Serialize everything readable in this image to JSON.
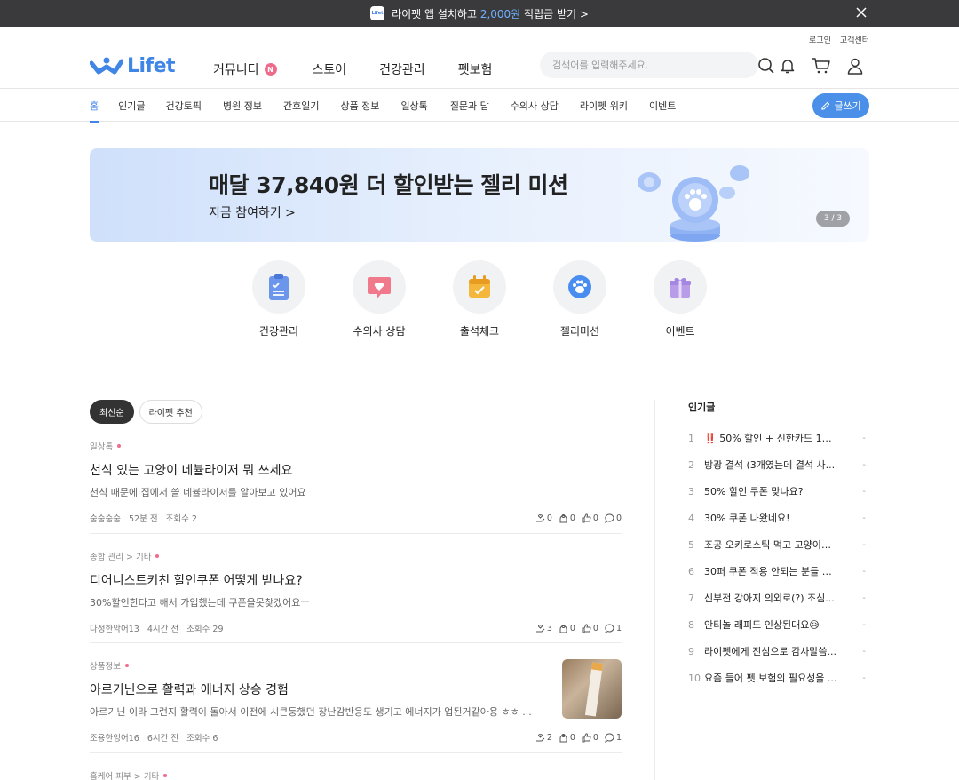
{
  "promo": {
    "text_before": "라이펫 앱 설치하고 ",
    "accent": "2,000원",
    "text_after": " 적립금 받기 >",
    "app_icon_text": "Lifet"
  },
  "header": {
    "logo": "Lifet",
    "util": [
      "로그인",
      "고객센터"
    ],
    "gnb": [
      "커뮤니티",
      "스토어",
      "건강관리",
      "펫보험"
    ],
    "gnb_badge": "N",
    "search_placeholder": "검색어를 입력해주세요."
  },
  "subnav": {
    "items": [
      "홈",
      "인기글",
      "건강토픽",
      "병원 정보",
      "간호일기",
      "상품 정보",
      "일상톡",
      "질문과 답",
      "수의사 상담",
      "라이펫 위키",
      "이벤트"
    ],
    "active": "홈",
    "write": "글쓰기"
  },
  "banner": {
    "title": "매달 37,840원 더 할인받는 젤리 미션",
    "cta": "지금 참여하기 >",
    "pager": "3 / 3"
  },
  "quick": [
    "건강관리",
    "수의사 상담",
    "출석체크",
    "젤리미션",
    "이벤트"
  ],
  "feed": {
    "chips": [
      "최신순",
      "라이펫 추천"
    ],
    "posts": [
      {
        "cat": "일상톡",
        "title": "천식 있는 고양이 네뷸라이저 뭐 쓰세요",
        "excerpt": "천식 때문에 집에서 쓸 네뷸라이저를 알아보고 있어요",
        "author": "숨숨숨숨",
        "time": "52분 전",
        "views": "조회수 2",
        "s1": "0",
        "s2": "0",
        "s3": "0",
        "s4": "0"
      },
      {
        "cat": "종합 관리 > 기타",
        "title": "디어니스트키친 할인쿠폰 어떻게 받나요?",
        "excerpt": "30%할인한다고 해서 가입했는데 쿠폰을못찾겠어요ㅜ",
        "author": "다정한악어13",
        "time": "4시간 전",
        "views": "조회수 29",
        "s1": "3",
        "s2": "0",
        "s3": "0",
        "s4": "1"
      },
      {
        "cat": "상품정보",
        "title": "아르기닌으로 활력과 에너지 상승 경험",
        "excerpt": "아르기닌 이라 그런지 활력이 돌아서 이전에 시큰둥했던 장난감반응도 생기고 에너지가 업된거같아용 ㅎㅎ ...",
        "author": "조용한잉어16",
        "time": "6시간 전",
        "views": "조회수 6",
        "s1": "2",
        "s2": "0",
        "s3": "0",
        "s4": "1"
      },
      {
        "cat": "홈케어 피부 > 기타"
      }
    ]
  },
  "popular": {
    "head": "인기글",
    "items": [
      {
        "n": "1",
        "t": "‼️ 50% 할인 + 신한카드 12...",
        "d": "-"
      },
      {
        "n": "2",
        "t": "방광 결석 (3개였는데 결석 사...",
        "d": "-"
      },
      {
        "n": "3",
        "t": "50% 할인 쿠폰 맞나요?",
        "d": "-"
      },
      {
        "n": "4",
        "t": "30% 쿠폰 나왔네요!",
        "d": "-"
      },
      {
        "n": "5",
        "t": "조공 오키로스틱 먹고 고양이들...",
        "d": "-"
      },
      {
        "n": "6",
        "t": "30퍼 쿠폰 적용 안되는 분들 이...",
        "d": "-"
      },
      {
        "n": "7",
        "t": "신부전 강아지 의외로(?) 조심...",
        "d": "-"
      },
      {
        "n": "8",
        "t": "안티놀 래피드 인상된대요😥",
        "d": "-"
      },
      {
        "n": "9",
        "t": "라이펫에게 진심으로 감사말씀...",
        "d": "-"
      },
      {
        "n": "10",
        "t": "요즘 들어 펫 보험의 필요성을 ...",
        "d": "-"
      }
    ]
  },
  "colors": {
    "brand": "#3f86e6",
    "badge": "#ef6b8c",
    "dark": "#3a3a3c"
  }
}
